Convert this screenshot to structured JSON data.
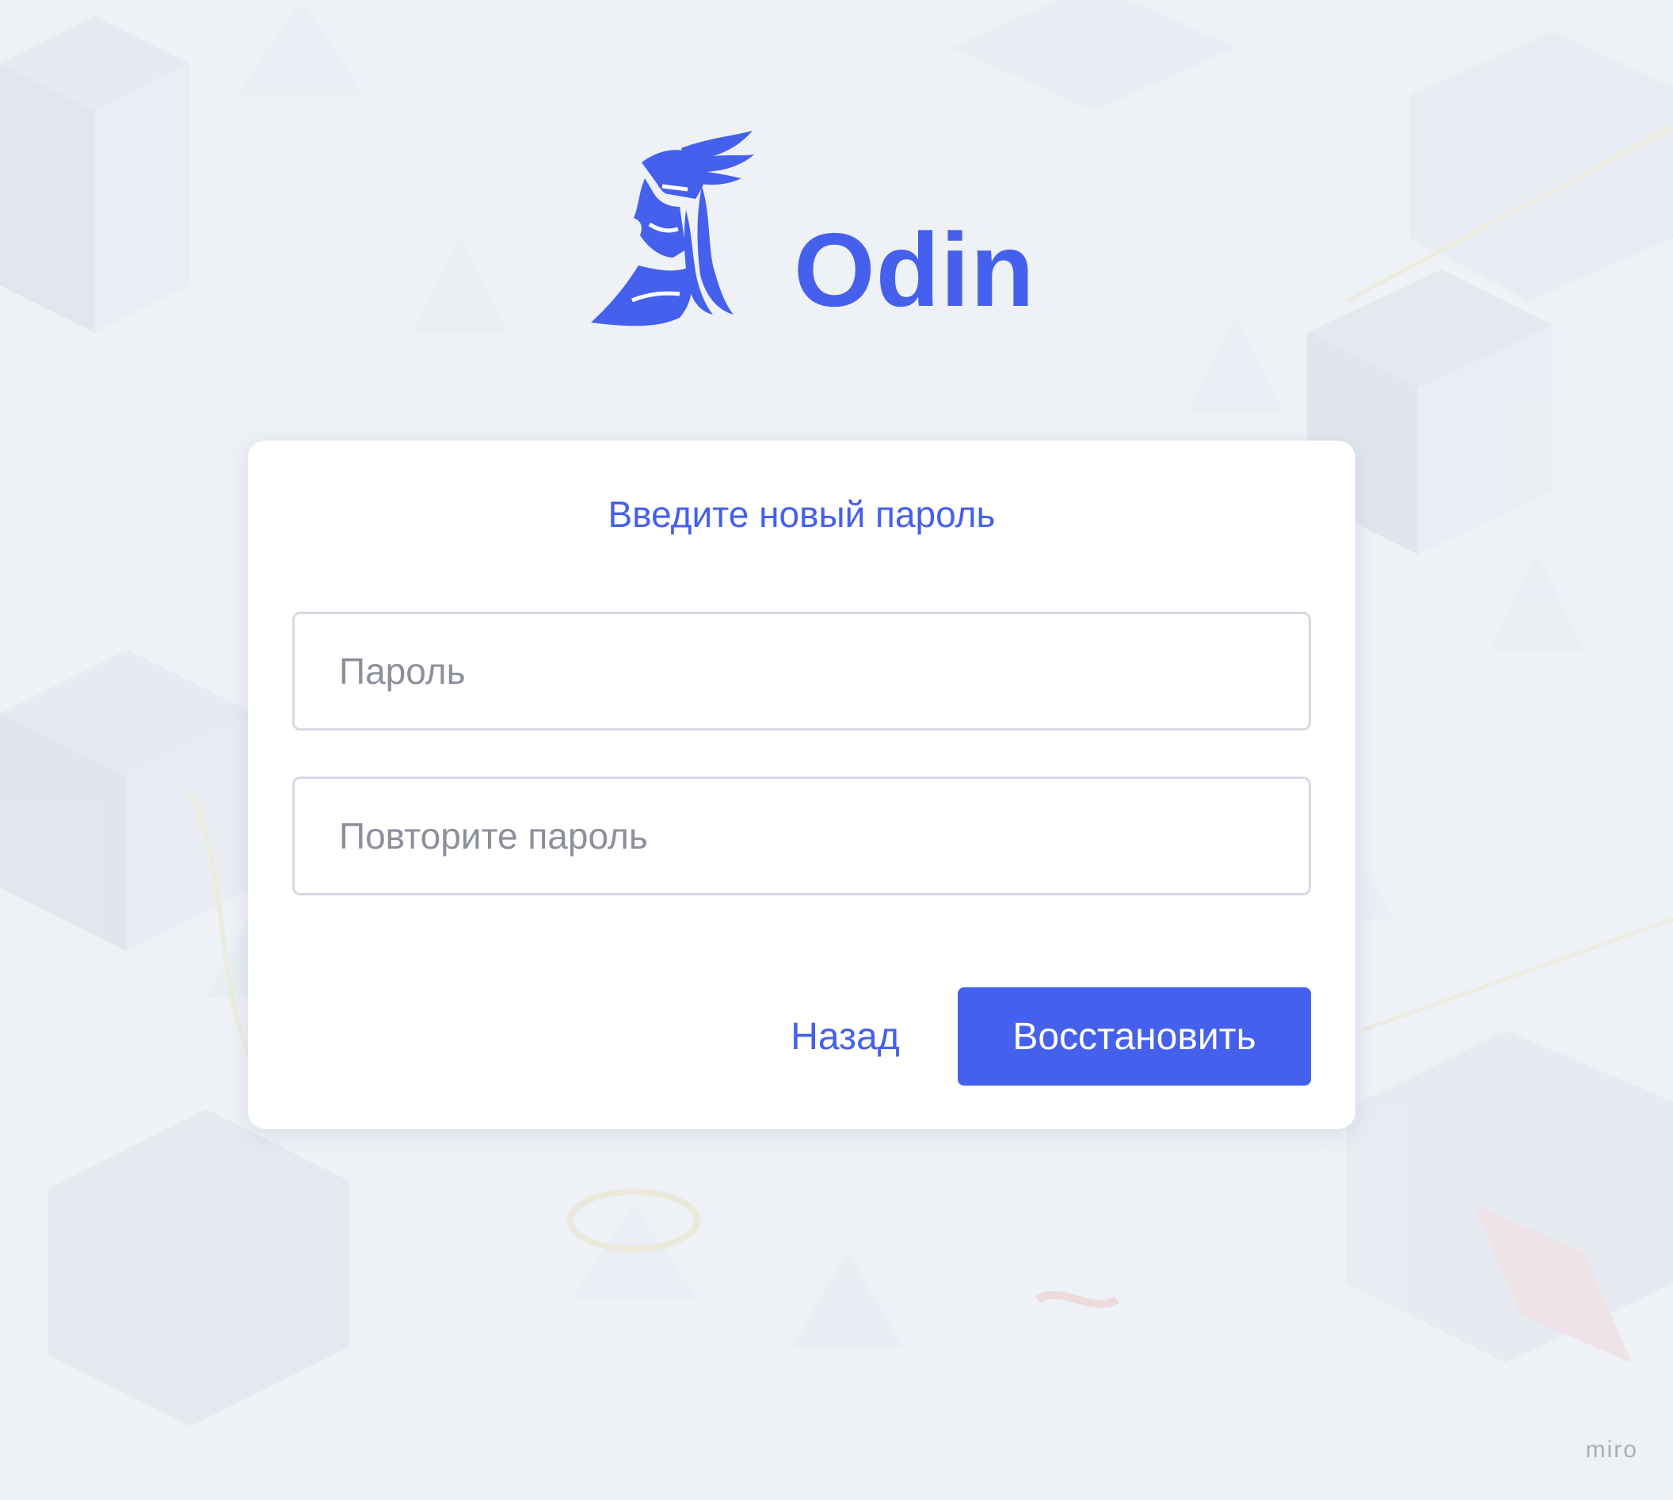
{
  "brand": {
    "name": "Odin",
    "logo_icon": "viking-head-logo-icon"
  },
  "form": {
    "title": "Введите новый пароль",
    "password_placeholder": "Пароль",
    "repeat_password_placeholder": "Повторите пароль",
    "back_label": "Назад",
    "restore_label": "Восстановить"
  },
  "watermark": "miro",
  "colors": {
    "accent": "#4560ec",
    "background": "#eef1f6",
    "card": "#ffffff",
    "placeholder": "#8c909a",
    "border": "#d6dae2"
  }
}
